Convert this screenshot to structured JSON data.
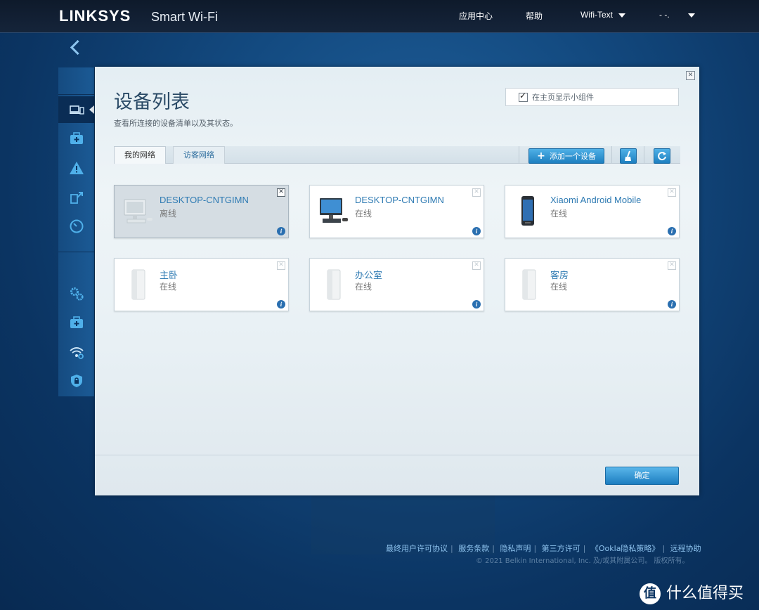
{
  "header": {
    "logo": "LINKSYS",
    "logo_sub": "Smart Wi-Fi",
    "nav_app_center": "应用中心",
    "nav_help": "帮助",
    "nav_wifi": "Wifi-Text",
    "nav_user": "- -."
  },
  "sidebar": {
    "items": [
      {
        "icon": "devices-icon"
      },
      {
        "icon": "parental-controls-icon"
      },
      {
        "icon": "alert-icon"
      },
      {
        "icon": "media-prioritization-icon"
      },
      {
        "icon": "speed-test-icon"
      },
      {
        "icon": "settings-gears-icon"
      },
      {
        "icon": "troubleshooting-icon"
      },
      {
        "icon": "wireless-settings-icon"
      },
      {
        "icon": "security-icon"
      }
    ]
  },
  "modal": {
    "title": "设备列表",
    "description": "查看所连接的设备清单以及其状态。",
    "show_widget_label": "在主页显示小组件",
    "show_widget_checked": true,
    "tabs": {
      "my_network": "我的网络",
      "guest_network": "访客网络"
    },
    "add_device_label": "添加一个设备",
    "ok_label": "确定"
  },
  "devices": [
    {
      "name": "DESKTOP-CNTGIMN",
      "status": "离线",
      "type": "desktop",
      "offline": true
    },
    {
      "name": "DESKTOP-CNTGIMN",
      "status": "在线",
      "type": "desktop",
      "offline": false
    },
    {
      "name": "Xiaomi Android Mobile",
      "status": "在线",
      "type": "mobile",
      "offline": false
    },
    {
      "name": "主卧",
      "status": "在线",
      "type": "node",
      "offline": false
    },
    {
      "name": "办公室",
      "status": "在线",
      "type": "node",
      "offline": false
    },
    {
      "name": "客房",
      "status": "在线",
      "type": "node",
      "offline": false
    }
  ],
  "footer": {
    "links": [
      "最终用户许可协议",
      "服务条款",
      "隐私声明",
      "第三方许可",
      "《Ookla隐私策略》",
      "远程协助"
    ],
    "copyright": "© 2021 Belkin International, Inc. 及/或其附属公司。 版权所有。"
  },
  "watermark": {
    "badge": "值",
    "text": "什么值得买"
  }
}
